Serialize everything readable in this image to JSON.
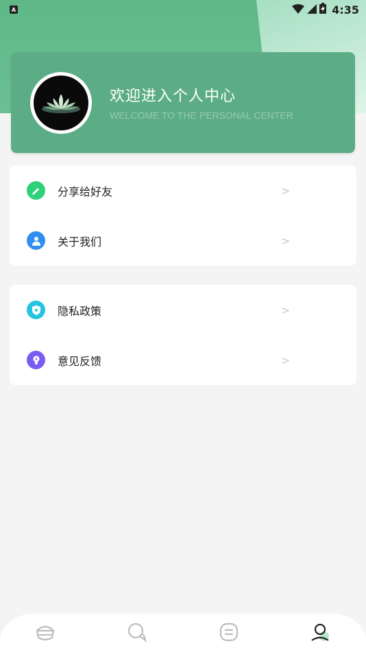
{
  "status_bar": {
    "indicator": "A",
    "time": "4:35",
    "icons": [
      "wifi-icon",
      "signal-icon",
      "battery-charging-icon"
    ]
  },
  "profile": {
    "title": "欢迎进入个人中心",
    "subtitle": "WELCOME TO THE PERSONAL CENTER",
    "avatar": "lotus-avatar"
  },
  "menu": {
    "group1": [
      {
        "label": "分享给好友",
        "icon": "share-icon",
        "color": "#2fd07a"
      },
      {
        "label": "关于我们",
        "icon": "about-us-icon",
        "color": "#2f8ff0"
      }
    ],
    "group2": [
      {
        "label": "隐私政策",
        "icon": "privacy-shield-icon",
        "color": "#23c4e0"
      },
      {
        "label": "意见反馈",
        "icon": "feedback-bulb-icon",
        "color": "#7a5cf0"
      }
    ],
    "chevron": ">"
  },
  "bottom_nav": {
    "items": [
      "home-icon",
      "chat-icon",
      "notes-icon",
      "profile-icon"
    ],
    "active_index": 3
  },
  "colors": {
    "accent": "#5cad85",
    "background": "#f4f4f4"
  }
}
